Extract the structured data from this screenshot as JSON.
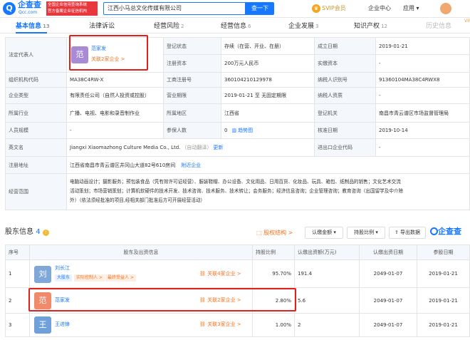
{
  "topbar": {
    "logo_mark": "Q",
    "logo_name": "企查查",
    "logo_url": "Qcc.com",
    "badge_line1": "全国企业信用查询系统",
    "badge_line2": "官方备案企业征信机构",
    "search_value": "江西小马总文化传媒有限公司",
    "search_button": "查一下",
    "vip_label": "SVIP会员",
    "enterprise_center": "企业中心",
    "apps": "应用 ▾"
  },
  "tabs": [
    {
      "label": "基本信息",
      "count": "13"
    },
    {
      "label": "法律诉讼",
      "count": ""
    },
    {
      "label": "经营风险",
      "count": "2"
    },
    {
      "label": "经营信息",
      "count": "6"
    },
    {
      "label": "企业发展",
      "count": "3"
    },
    {
      "label": "知识产权",
      "count": "12"
    },
    {
      "label": "历史信息",
      "count": ""
    }
  ],
  "vip_badge": "VIP",
  "info": {
    "legal_rep_label": "法定代表人",
    "legal_rep_avatar": "范",
    "legal_rep_name": "范家发",
    "legal_rep_related": "关联2家企业 >",
    "reg_status_label": "登记状态",
    "reg_status_value": "存续（在营、开业、在册）",
    "found_date_label": "成立日期",
    "found_date_value": "2019-01-21",
    "reg_capital_label": "注册资本",
    "reg_capital_value": "200万元人民币",
    "paid_capital_label": "实缴资本",
    "paid_capital_value": "-",
    "org_code_label": "组织机构代码",
    "org_code_value": "MA38C4RW-X",
    "biz_reg_no_label": "工商注册号",
    "biz_reg_no_value": "360104210129978",
    "taxpayer_id_label": "纳税人识别号",
    "taxpayer_id_value": "91360104MA38C4RWX8",
    "company_type_label": "企业类型",
    "company_type_value": "有限责任公司（自然人投资或控股）",
    "biz_term_label": "营业期限",
    "biz_term_value": "2019-01-21 至 无固定期限",
    "taxpayer_qual_label": "纳税人资质",
    "taxpayer_qual_value": "-",
    "industry_label": "所属行业",
    "industry_value": "广播、电视、电影和录音制作业",
    "region_label": "所属地区",
    "region_value": "江西省",
    "reg_authority_label": "登记机关",
    "reg_authority_value": "南昌市青云谱区市场监督管理局",
    "staff_size_label": "人员规模",
    "staff_size_value": "-",
    "insured_label": "参保人数",
    "insured_value": "0",
    "insured_trend": "趋势图",
    "approval_date_label": "核准日期",
    "approval_date_value": "2019-10-14",
    "english_name_label": "英文名",
    "english_name_value": "Jiangxi Xiaomazhong Culture Media Co., Ltd.",
    "english_name_note": "（自动翻译）",
    "english_name_update": "更新",
    "import_export_label": "进出口企业代码",
    "import_export_value": "-",
    "address_label": "注册地址",
    "address_value": "江西省南昌市青云谱区井冈山大道82号610房间",
    "nearby_companies": "附近企业",
    "scope_label": "经营范围",
    "scope_line1": "电脑动画设计；摄影服务；预包装食品（凭有效许可证经营）、服装鞋帽、办公设备、文化用品、日用百货、化妆品、玩具、箱包、纸制品的销售；文化艺术交流",
    "scope_line2": "活动策划；市场营销策划；计算机软硬件的技术开发、技术咨询、技术服务、技术转让；会务服务；经济信息咨询；企业管理咨询；教育咨询（出国留学及中介除",
    "scope_line3": "外）（依法须经批准的项目,经相关部门批准后方可开展经营活动）"
  },
  "shareholders": {
    "title": "股东信息",
    "count": "4",
    "equity_structure": "股权结构 >",
    "subscribed_btn": "认缴金额 ▾",
    "ratio_btn": "持股比例 ▾",
    "export_btn": "导出数据",
    "brand": "企查查",
    "columns": [
      "序号",
      "股东及出资信息",
      "持股比例",
      "认缴出资额(万元)",
      "认缴出资日期",
      "参股日期"
    ],
    "rows": [
      {
        "no": "1",
        "avatar": "刘",
        "name": "刘长江",
        "tags": [
          "大股东",
          "实际控制人 >",
          "最终受益人 >"
        ],
        "related": "关联4家企业 >",
        "ratio": "95.70%",
        "amount": "191.4",
        "sub_date": "2049-01-07",
        "join_date": "2019-01-21"
      },
      {
        "no": "2",
        "avatar": "范",
        "name": "范家发",
        "tags": [],
        "related": "关联2家企业 >",
        "ratio": "2.80%",
        "amount": "5.6",
        "sub_date": "2049-01-07",
        "join_date": "2019-01-21"
      },
      {
        "no": "3",
        "avatar": "王",
        "name": "王进锋",
        "tags": [],
        "related": "关联3家企业 >",
        "ratio": "1.00%",
        "amount": "2",
        "sub_date": "2049-01-07",
        "join_date": "2019-01-21"
      }
    ]
  },
  "colors": {
    "accent": "#1677ff",
    "highlight": "#e0201b",
    "orange": "#f4731c"
  }
}
